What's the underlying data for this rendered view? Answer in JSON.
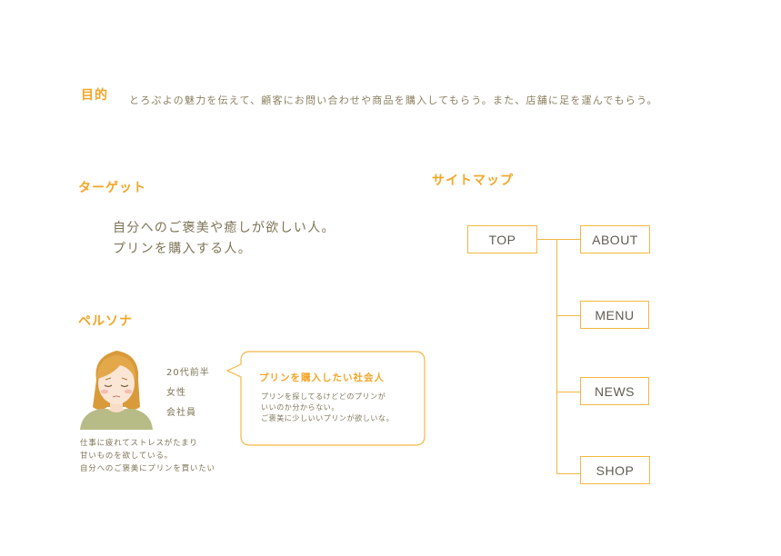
{
  "purpose": {
    "label": "目的",
    "text": "とろぷよの魅力を伝えて、顧客にお問い合わせや商品を購入してもらう。また、店舗に足を運んでもらう。"
  },
  "target": {
    "label": "ターゲット",
    "lines": [
      "自分へのご褒美や癒しが欲しい人。",
      "プリンを購入する人。"
    ]
  },
  "persona": {
    "label": "ペルソナ",
    "info": [
      "20代前半",
      "女性",
      "会社員"
    ],
    "description": [
      "仕事に疲れてストレスがたまり",
      "甘いものを欲している。",
      "自分へのご褒美にプリンを買いたい"
    ],
    "bubble": {
      "title": "プリンを購入したい社会人",
      "lines": [
        "プリンを探してるけどどのプリンが",
        "いいのか分からない。",
        "ご褒美に少しいいプリンが欲しいな。"
      ]
    }
  },
  "sitemap": {
    "label": "サイトマップ",
    "root": "TOP",
    "children": [
      "ABOUT",
      "MENU",
      "NEWS",
      "SHOP"
    ]
  },
  "colors": {
    "accent": "#f2a626",
    "text": "#7d7457",
    "line": "#f2b844"
  }
}
